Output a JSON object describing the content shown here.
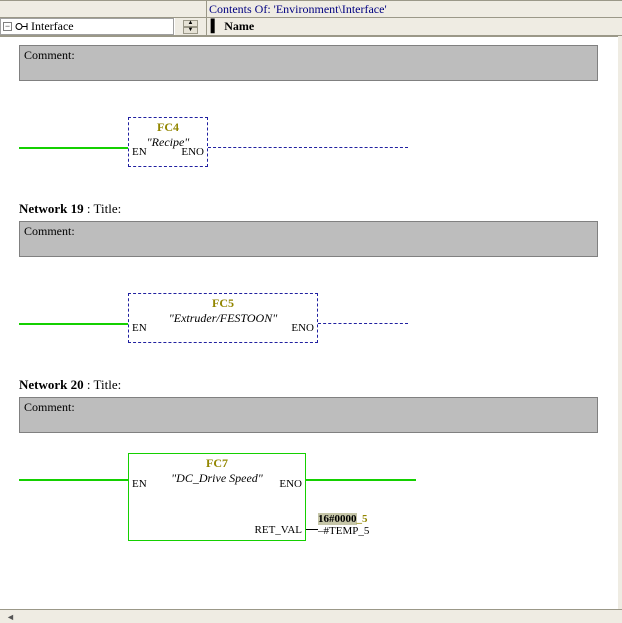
{
  "header": {
    "contents_prefix": "Contents Of: ",
    "contents_path": "'Environment\\Interface'"
  },
  "tree": {
    "root_label": "Interface"
  },
  "columns": {
    "name": "Name"
  },
  "blocks": [
    {
      "comment_label": "Comment:",
      "fc_id": "FC4",
      "fc_desc": "\"Recipe\"",
      "pin_en": "EN",
      "pin_eno": "ENO"
    },
    {
      "net_num": "Network 19",
      "net_sep": " : ",
      "net_title_label": "Title:",
      "comment_label": "Comment:",
      "fc_id": "FC5",
      "fc_desc": "\"Extruder/FESTOON\"",
      "pin_en": "EN",
      "pin_eno": "ENO"
    },
    {
      "net_num": "Network 20",
      "net_sep": " : ",
      "net_title_label": "Title:",
      "comment_label": "Comment:",
      "fc_id": "FC7",
      "fc_desc": "\"DC_Drive Speed\"",
      "pin_en": "EN",
      "pin_eno": "ENO",
      "ret_label": "RET_VAL",
      "out_hex": "16#0000",
      "out_suffix": "_5",
      "out_temp": "#TEMP_5"
    }
  ]
}
